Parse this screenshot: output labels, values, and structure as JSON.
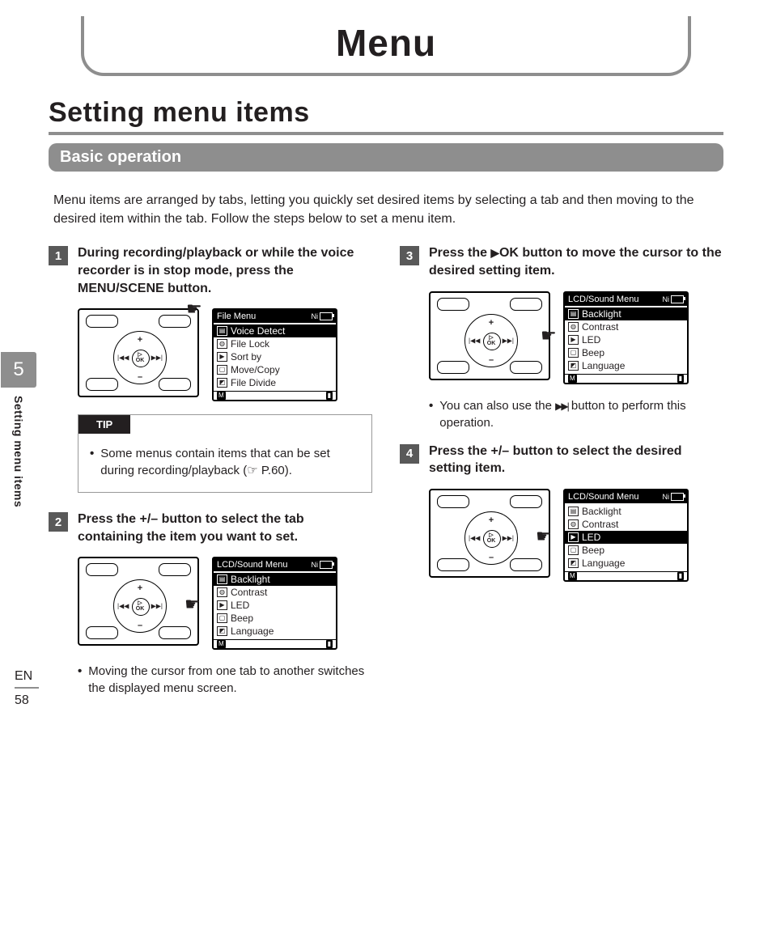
{
  "chapter_header": "Menu",
  "section_title": "Setting menu items",
  "sub_header": "Basic operation",
  "intro_text": "Menu items are arranged by tabs, letting you quickly set desired items by selecting a tab and then moving to the desired item within the tab. Follow the steps below to set a menu item.",
  "side": {
    "chapter_num": "5",
    "label": "Setting menu items"
  },
  "footer": {
    "lang": "EN",
    "page": "58"
  },
  "steps": {
    "s1": {
      "num": "1",
      "text_a": "During recording/playback or while the voice recorder is in stop mode, press the ",
      "text_b": "MENU/SCENE",
      "text_c": " button."
    },
    "s2": {
      "num": "2",
      "text_a": "Press the ",
      "text_b": "+/–",
      "text_c": " button to select the tab containing the item you want to set."
    },
    "s3": {
      "num": "3",
      "text_a": "Press the ",
      "text_b": "OK",
      "text_c": " button to move the cursor to the desired setting item."
    },
    "s4": {
      "num": "4",
      "text_a": "Press the ",
      "text_b": "+/–",
      "text_c": " button to select the desired setting item."
    }
  },
  "tip": {
    "label": "TIP",
    "bullet_a": "Some menus contain items that can be set during recording/playback (",
    "bullet_ref": " P.60",
    "bullet_b": ")."
  },
  "notes": {
    "n2": "Moving the cursor from one tab to another switches the displayed menu screen.",
    "n3_a": "You can also use the ",
    "n3_b": " button to perform this operation."
  },
  "lcd": {
    "file_menu": {
      "title": "File Menu",
      "batt": "Ni",
      "items": [
        "Voice Detect",
        "File Lock",
        "Sort by",
        "Move/Copy",
        "File Divide"
      ],
      "selected": 0
    },
    "lcd_sound": {
      "title": "LCD/Sound Menu",
      "batt": "Ni",
      "items": [
        "Backlight",
        "Contrast",
        "LED",
        "Beep",
        "Language"
      ]
    },
    "sel_backlight": 0,
    "sel_led": 2
  },
  "dpad": {
    "plus": "+",
    "minus": "–",
    "ok_glyph": "▷",
    "ok_label": "OK",
    "left": "|◀◀",
    "right": "▶▶|"
  },
  "icons": {
    "file": "▤",
    "mic": "◍",
    "play": "▶",
    "screen": "▢",
    "lang": "◩"
  }
}
